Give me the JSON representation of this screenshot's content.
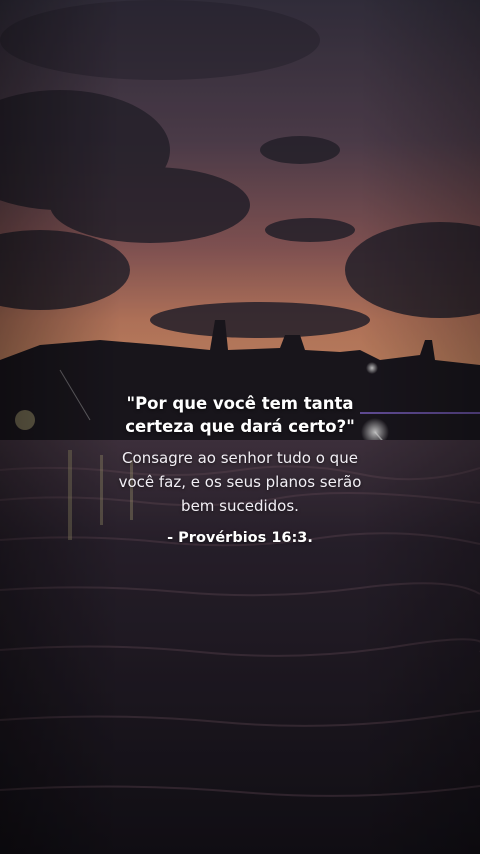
{
  "quote": {
    "title": "\"Por que você tem tanta\ncerteza que dará certo?\"",
    "body": "Consagre ao senhor tudo o que\nvocê faz, e os seus planos serão\nbem sucedidos.",
    "reference": "- Provérbios 16:3."
  },
  "colors": {
    "text": "#ffffff",
    "sky_top": "#3a3445",
    "sky_horizon": "#d98a6a",
    "water": "#1e1a24"
  }
}
